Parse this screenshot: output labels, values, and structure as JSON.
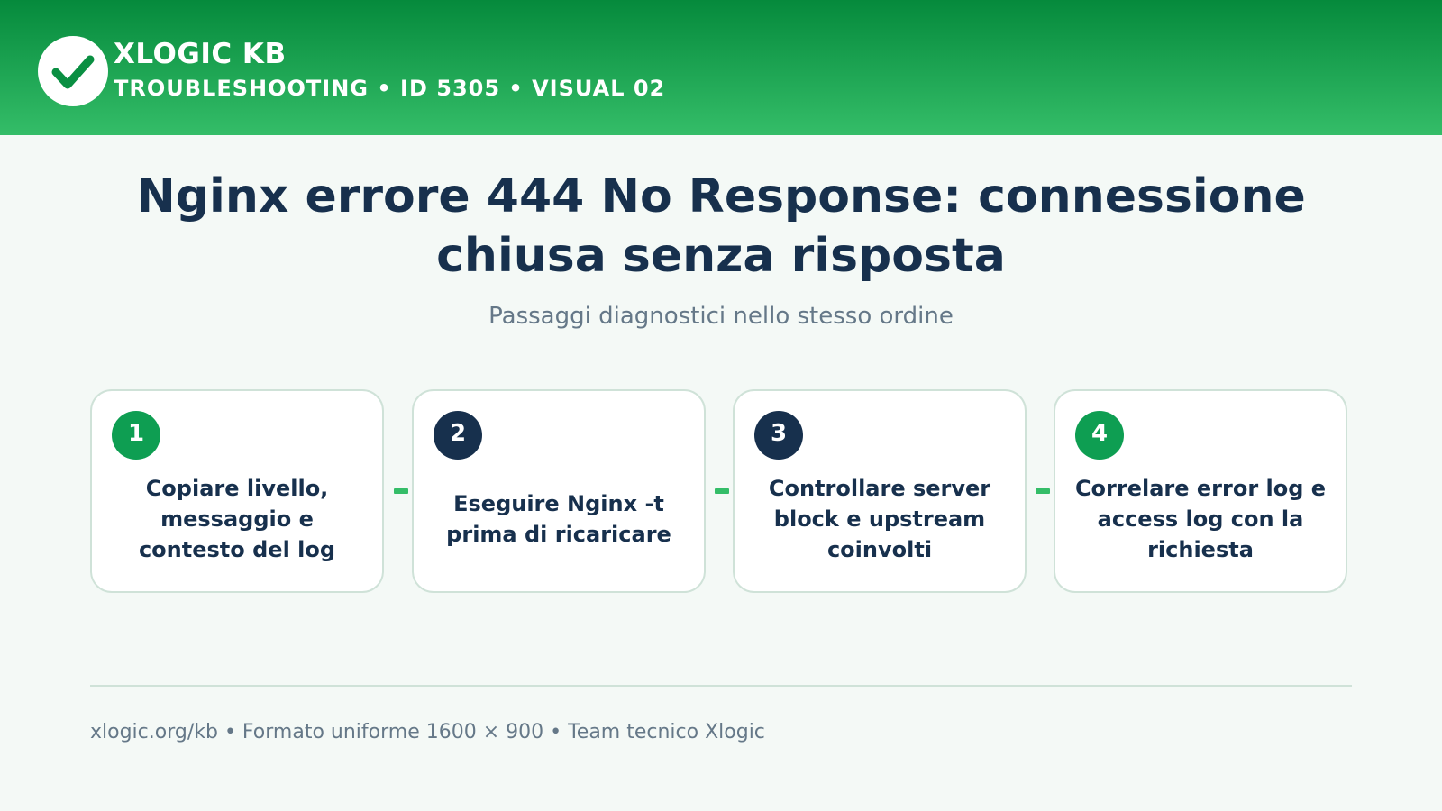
{
  "header": {
    "brand": "XLOGIC KB",
    "subbrand": "TROUBLESHOOTING • ID 5305 • VISUAL 02",
    "logo_icon": "checkmark-icon"
  },
  "main": {
    "title": "Nginx errore 444 No Response: connessione chiusa senza risposta",
    "subtitle": "Passaggi diagnostici nello stesso ordine"
  },
  "steps": [
    {
      "number": "1",
      "text": "Copiare livello, messaggio e contesto del log"
    },
    {
      "number": "2",
      "text": "Eseguire Nginx -t prima di ricaricare"
    },
    {
      "number": "3",
      "text": "Controllare server block e upstream coinvolti"
    },
    {
      "number": "4",
      "text": "Correlare error log e access log con la richiesta"
    }
  ],
  "footer": {
    "text": "xlogic.org/kb • Formato uniforme 1600 × 900 • Team tecnico Xlogic"
  },
  "colors": {
    "header_dark": "#058a3c",
    "header_light": "#34bd68",
    "navy": "#17304d",
    "green_badge": "#0e9e52",
    "muted_text": "#657888",
    "background": "#f4f9f6"
  }
}
